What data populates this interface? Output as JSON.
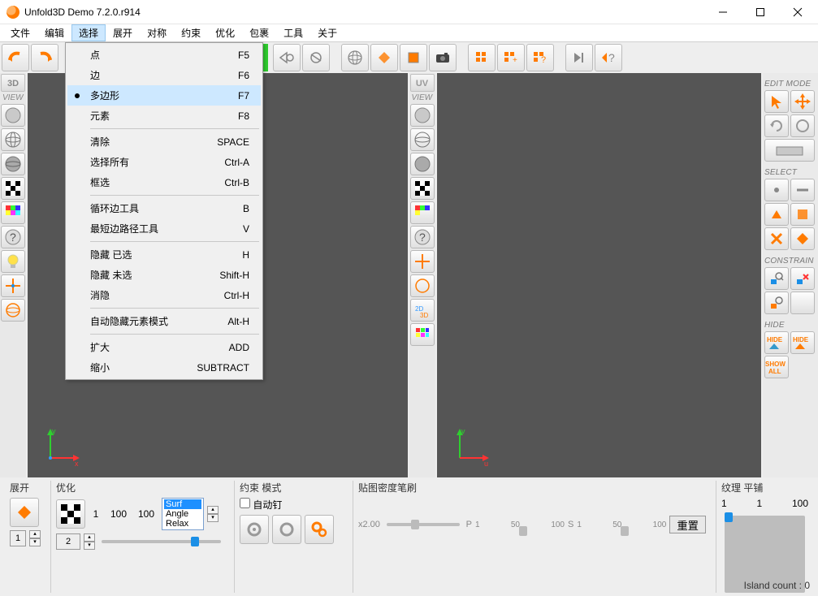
{
  "title": "Unfold3D Demo 7.2.0.r914",
  "menus": [
    "文件",
    "编辑",
    "选择",
    "展开",
    "对称",
    "约束",
    "优化",
    "包裹",
    "工具",
    "关于"
  ],
  "dropdown": {
    "items": [
      {
        "label": "点",
        "shortcut": "F5"
      },
      {
        "label": "边",
        "shortcut": "F6"
      },
      {
        "label": "多边形",
        "shortcut": "F7",
        "selected": true,
        "bullet": true
      },
      {
        "label": "元素",
        "shortcut": "F8"
      },
      {
        "sep": true
      },
      {
        "label": "清除",
        "shortcut": "SPACE"
      },
      {
        "label": "选择所有",
        "shortcut": "Ctrl-A"
      },
      {
        "label": "框选",
        "shortcut": "Ctrl-B"
      },
      {
        "sep": true
      },
      {
        "label": "循环边工具",
        "shortcut": "B"
      },
      {
        "label": "最短边路径工具",
        "shortcut": "V"
      },
      {
        "sep": true
      },
      {
        "label": "隐藏 已选",
        "shortcut": "H"
      },
      {
        "label": "隐藏 未选",
        "shortcut": "Shift-H"
      },
      {
        "label": "消隐",
        "shortcut": "Ctrl-H"
      },
      {
        "sep": true
      },
      {
        "label": "自动隐藏元素模式",
        "shortcut": "Alt-H"
      },
      {
        "sep": true
      },
      {
        "label": "扩大",
        "shortcut": "ADD"
      },
      {
        "label": "缩小",
        "shortcut": "SUBTRACT"
      }
    ]
  },
  "left_header": "3D",
  "right_header": "UV",
  "view_label": "VIEW",
  "right_panel": {
    "edit_mode": "EDIT MODE",
    "select": "SELECT",
    "constrain": "CONSTRAIN",
    "hide": "HIDE"
  },
  "bottom": {
    "expand": "展开",
    "optimize": "优化",
    "constraint": "约束 模式",
    "autopin": "自动钉",
    "brush": "贴图密度笔刷",
    "texture": "纹理 平铺",
    "x2": "x2.00",
    "p": "P",
    "s": "S",
    "reset": "重置",
    "opt_vals": {
      "a": "1",
      "b": "100",
      "c": "100"
    },
    "sel_options": [
      "Surf",
      "Angle",
      "Relax"
    ],
    "tex_vals": {
      "a": "1",
      "b": "1",
      "c": "100"
    },
    "brush_ticks": {
      "a": "1",
      "b": "50",
      "c": "100",
      "d": "1",
      "e": "50",
      "f": "100"
    },
    "step1": "1",
    "step2": "2"
  },
  "status": "Island count : 0",
  "axis": {
    "x": "x",
    "y": "y"
  }
}
